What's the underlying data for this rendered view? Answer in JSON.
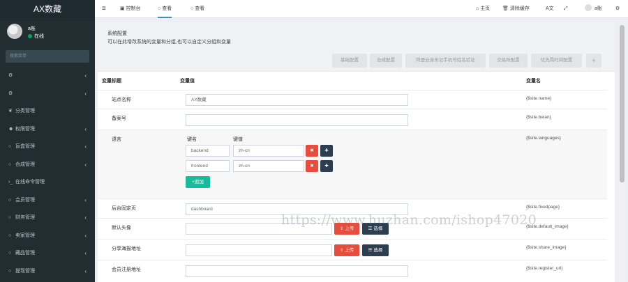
{
  "sidebar": {
    "brand": "AX数藏",
    "user": {
      "name": "a账",
      "status": "在线"
    },
    "search_placeholder": "搜索菜单",
    "items": [
      {
        "icon": "cog",
        "label": "",
        "chev": "‹"
      },
      {
        "icon": "cogs",
        "label": "",
        "chev": "‹"
      },
      {
        "icon": "leaf",
        "label": "分类管理",
        "chev": ""
      },
      {
        "icon": "users",
        "label": "权限管理",
        "chev": "‹"
      },
      {
        "icon": "circle",
        "label": "盲盒管理",
        "chev": "‹"
      },
      {
        "icon": "circle",
        "label": "合成管理",
        "chev": "‹"
      },
      {
        "icon": "terminal",
        "label": "在线命令管理",
        "chev": ""
      },
      {
        "icon": "circle",
        "label": "会员管理",
        "chev": "‹"
      },
      {
        "icon": "circle",
        "label": "财务管理",
        "chev": "‹"
      },
      {
        "icon": "circle",
        "label": "卖家管理",
        "chev": "‹"
      },
      {
        "icon": "circle",
        "label": "藏品管理",
        "chev": "‹"
      },
      {
        "icon": "circle",
        "label": "提现管理",
        "chev": "‹"
      }
    ]
  },
  "topbar": {
    "menu_toggle": "≡",
    "tabs": [
      {
        "label": "控制台"
      },
      {
        "label": "查看"
      },
      {
        "label": "查看"
      }
    ],
    "home": "主页",
    "clear_cache": "清除缓存",
    "username": "a账"
  },
  "panel": {
    "title": "系统配置",
    "desc": "可以在此增改系统的变量和分组,也可以自定义分组和变量",
    "group_tabs": [
      "基础配置",
      "合成配置",
      "阿里云身份证手机号姓名验证",
      "交易所配置",
      "优先购时间配置",
      "+"
    ]
  },
  "table": {
    "headers": {
      "title": "变量标题",
      "value": "变量值",
      "var": "变量名"
    },
    "rows": [
      {
        "label": "站点名称",
        "value": "AX数藏",
        "var": "{$site.name}"
      },
      {
        "label": "备案号",
        "value": "",
        "var": "{$site.beian}"
      },
      {
        "label": "语言",
        "var": "{$site.languages}",
        "sub_headers": {
          "key": "键名",
          "val": "键值"
        },
        "pairs": [
          {
            "key": "backend",
            "val": "zh-cn"
          },
          {
            "key": "frontend",
            "val": "zh-cn"
          }
        ],
        "add_label": "+追加"
      },
      {
        "label": "后台固定页",
        "value": "dashboard",
        "var": "{$site.fixedpage}"
      },
      {
        "label": "默认头像",
        "value": "",
        "var": "{$site.default_image}",
        "upload": "上传",
        "choose": "选择"
      },
      {
        "label": "分享海报地址",
        "value": "",
        "var": "{$site.share_image}",
        "upload": "上传",
        "choose": "选择"
      },
      {
        "label": "会员注册地址",
        "value": "",
        "var": "{$site.register_url}"
      }
    ]
  },
  "watermark": "https://www.huzhan.com/ishop47020",
  "colors": {
    "sidebar": "#222d32",
    "accent": "#3c8dbc",
    "danger": "#e74c3c",
    "dark": "#2c3e50",
    "success": "#18bc9c"
  }
}
